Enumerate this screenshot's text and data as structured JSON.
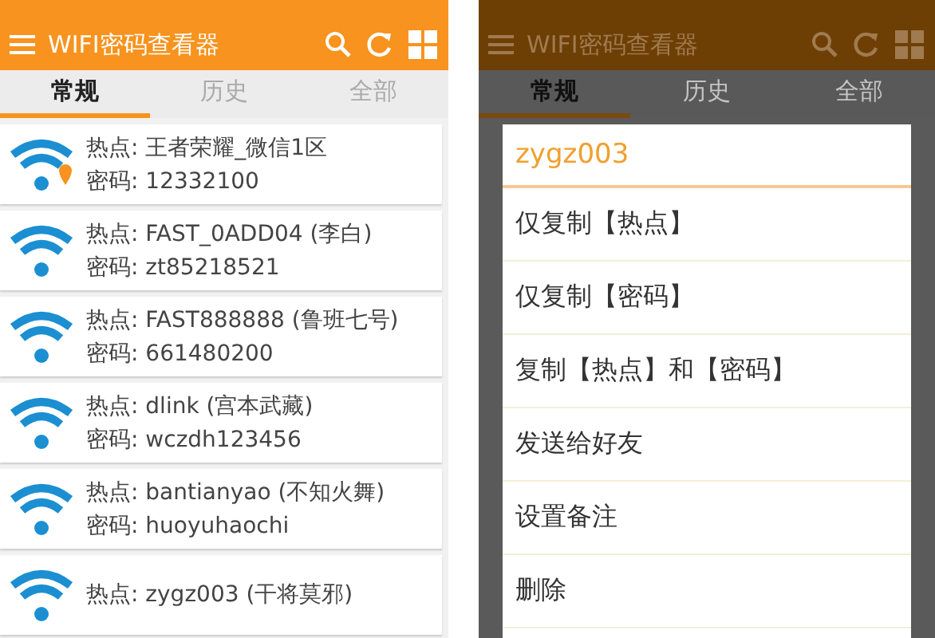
{
  "list_screen": {
    "app_bar": {
      "title": "WIFI密码查看器"
    },
    "tabs": [
      {
        "label": "常规",
        "selected": true
      },
      {
        "label": "历史",
        "selected": false
      },
      {
        "label": "全部",
        "selected": false
      }
    ],
    "rows": [
      {
        "hotspot": "热点: 王者荣耀_微信1区",
        "password": "密码: 12332100",
        "located": true
      },
      {
        "hotspot": "热点: FAST_0ADD04 (李白)",
        "password": "密码: zt85218521",
        "located": false
      },
      {
        "hotspot": "热点: FAST888888 (鲁班七号)",
        "password": "密码: 661480200",
        "located": false
      },
      {
        "hotspot": "热点: dlink (宫本武藏)",
        "password": "密码: wczdh123456",
        "located": false
      },
      {
        "hotspot": "热点: bantianyao (不知火舞)",
        "password": "密码: huoyuhaochi",
        "located": false
      },
      {
        "hotspot": "热点: zygz003 (干将莫邪)",
        "located": false
      }
    ]
  },
  "dialog_screen": {
    "app_bar": {
      "title": "WIFI密码查看器"
    },
    "tabs": [
      {
        "label": "常规",
        "selected": true
      },
      {
        "label": "历史",
        "selected": false
      },
      {
        "label": "全部",
        "selected": false
      }
    ],
    "dialog": {
      "title": "zygz003",
      "items": [
        "仅复制【热点】",
        "仅复制【密码】",
        "复制【热点】和【密码】",
        "发送给好友",
        "设置备注",
        "删除"
      ]
    }
  }
}
